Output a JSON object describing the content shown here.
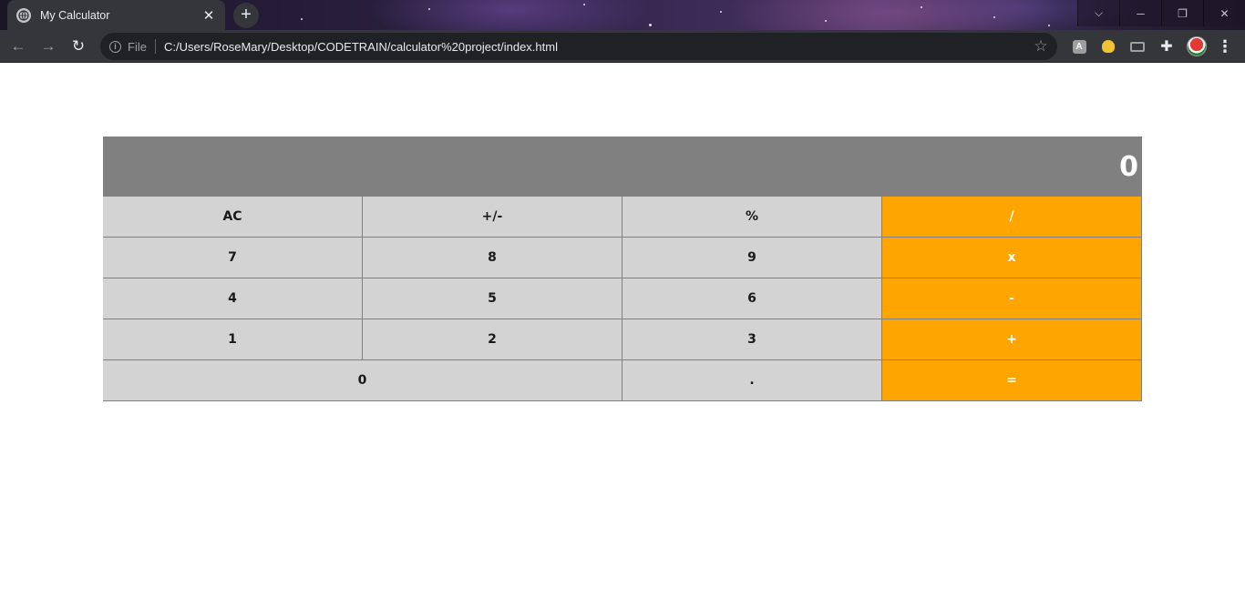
{
  "browser": {
    "tab": {
      "title": "My Calculator",
      "close": "✕",
      "icon": "globe-icon"
    },
    "new_tab": "+",
    "window_controls": {
      "dropdown": "⌵",
      "minimize": "─",
      "restore": "❐",
      "close": "✕"
    },
    "toolbar": {
      "back": "←",
      "forward": "→",
      "reload": "↻",
      "site_info": "i",
      "site_label": "File",
      "url": "C:/Users/RoseMary/Desktop/CODETRAIN/calculator%20project/index.html",
      "bookmark": "☆",
      "extensions_icon": "puzzle-icon",
      "menu": "⋮"
    }
  },
  "calculator": {
    "display_value": "0",
    "rows": [
      [
        {
          "label": "AC"
        },
        {
          "label": "+/-"
        },
        {
          "label": "%"
        },
        {
          "label": "/",
          "operator": true
        }
      ],
      [
        {
          "label": "7"
        },
        {
          "label": "8"
        },
        {
          "label": "9"
        },
        {
          "label": "x",
          "operator": true
        }
      ],
      [
        {
          "label": "4"
        },
        {
          "label": "5"
        },
        {
          "label": "6"
        },
        {
          "label": "-",
          "operator": true
        }
      ],
      [
        {
          "label": "1"
        },
        {
          "label": "2"
        },
        {
          "label": "3"
        },
        {
          "label": "+",
          "operator": true
        }
      ],
      [
        {
          "label": "0",
          "wide": true
        },
        {
          "label": "."
        },
        {
          "label": "=",
          "operator": true
        }
      ]
    ],
    "colors": {
      "display_bg": "#808080",
      "key_bg": "#d3d3d3",
      "operator_bg": "#ffa500",
      "operator_text": "#ffffff"
    }
  }
}
